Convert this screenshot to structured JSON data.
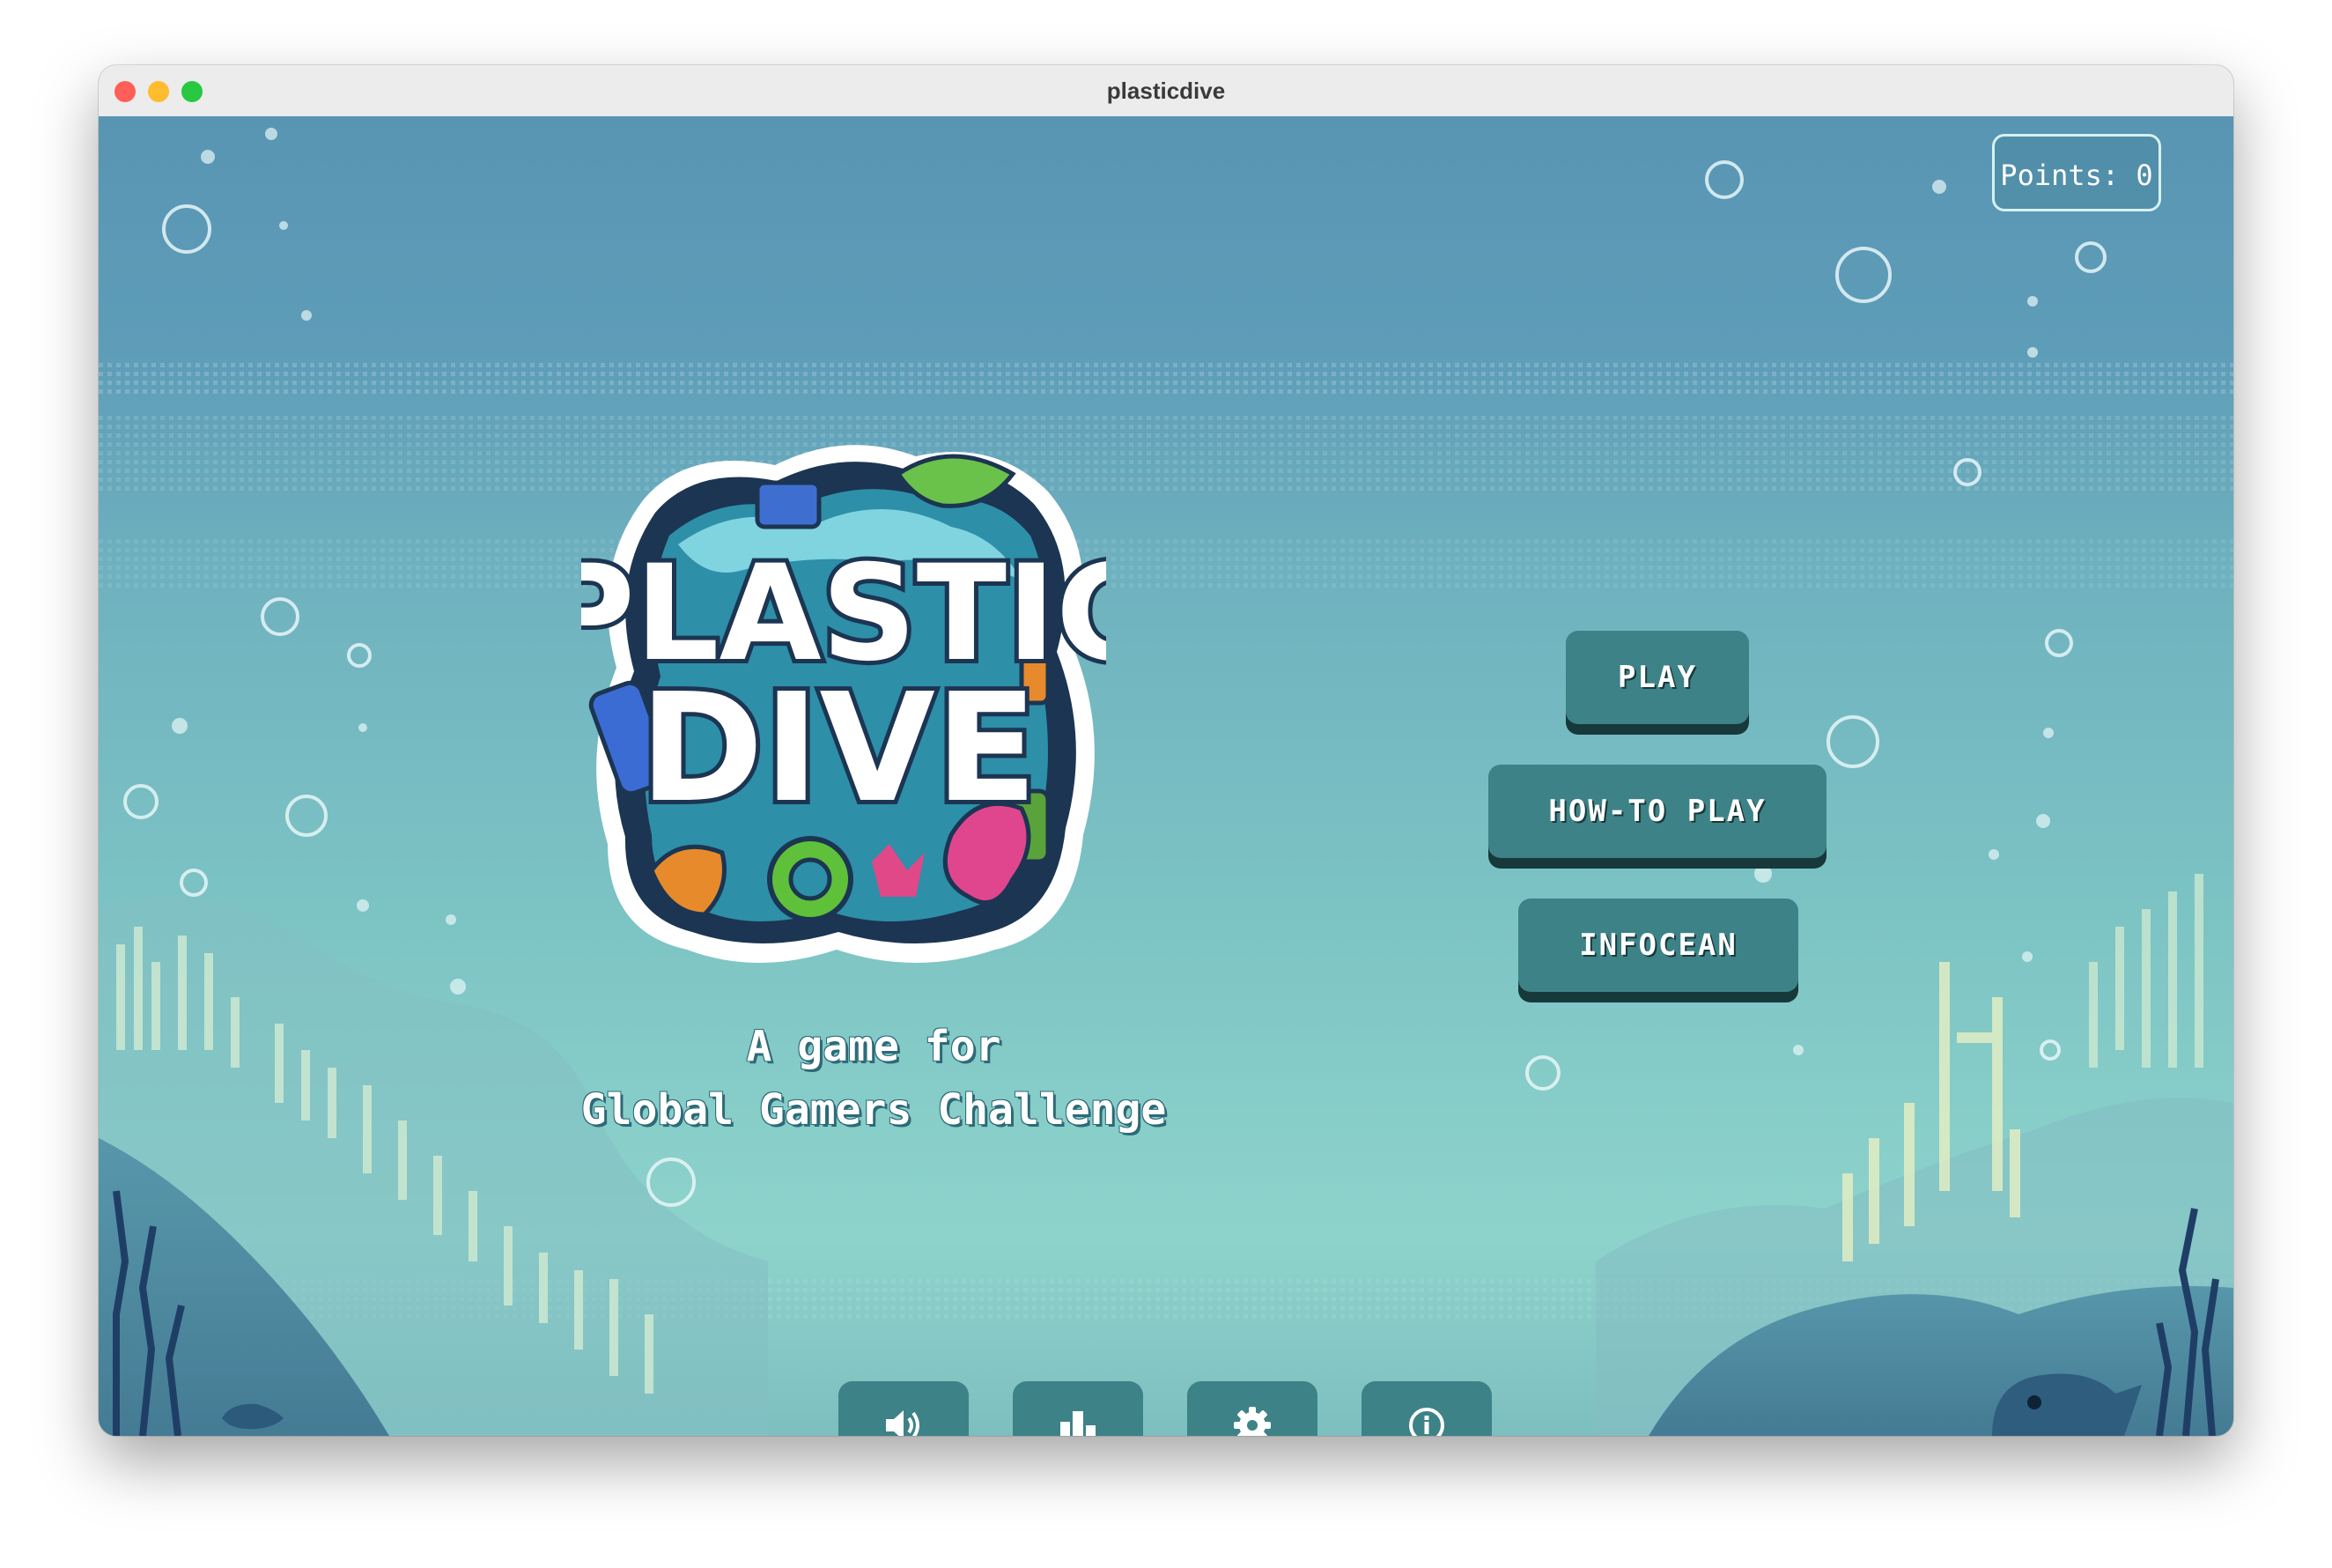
{
  "window": {
    "title": "plasticdive"
  },
  "hud": {
    "points_label": "Points: 0"
  },
  "logo": {
    "line1": "PLASTIC",
    "line2": "DIVE"
  },
  "tagline": {
    "line1": "A game for",
    "line2": "Global Gamers Challenge"
  },
  "menu": {
    "play_label": "PLAY",
    "how_to_play_label": "HOW-TO PLAY",
    "infocean_label": "INFOCEAN"
  },
  "toolbar": {
    "icons": [
      "speaker-icon",
      "bar-chart-icon",
      "gear-icon",
      "info-icon"
    ]
  },
  "colors": {
    "button": "#3d8286",
    "button_shadow": "#17393c",
    "water_top": "#5a97b4",
    "water_bottom": "#8fd2cc"
  }
}
